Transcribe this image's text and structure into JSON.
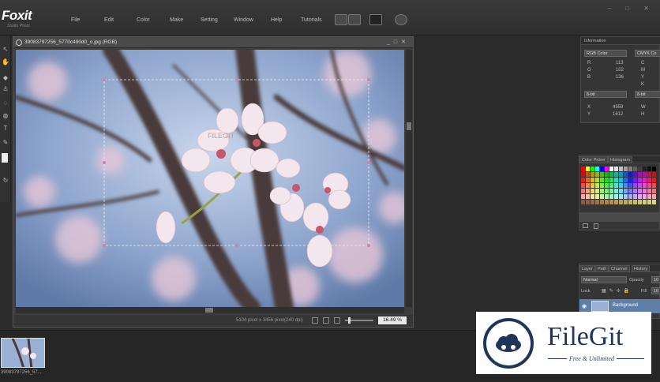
{
  "app": {
    "logo": "Foxit",
    "logo_sub": "Studio Photo"
  },
  "menu": [
    "File",
    "Edit",
    "Color",
    "Make",
    "Setting",
    "Window",
    "Help",
    "Tutorials"
  ],
  "toolbar_icons": [
    "arrange-windows-icon",
    "layer-stack-icon",
    "image-adjust-icon",
    "camera-icon"
  ],
  "left_tools": [
    "move-icon",
    "hand-icon",
    "eraser-icon",
    "clone-stamp-icon",
    "lasso-icon",
    "bucket-icon",
    "text-icon",
    "pen-icon",
    "document-icon",
    "rotate-icon"
  ],
  "document": {
    "title": "39083797256_5770c490d0_o.jpg (RGB)",
    "controls": [
      "_",
      "□",
      "✕"
    ],
    "dimensions": "5104 pixel x 3456 pixel(240 dpi)",
    "zoom": "16.49 %",
    "watermark": "FILEGIT"
  },
  "thumbnail": {
    "name": "39083797256_57..."
  },
  "info_panel": {
    "title": "Information",
    "rgb_mode": "RGB Color",
    "cmyk_mode": "CMYK Co",
    "rgb_labels": [
      "R",
      "G",
      "B"
    ],
    "rgb_values": [
      "113",
      "102",
      "136"
    ],
    "cmyk_labels": [
      "C",
      "M",
      "Y",
      "K"
    ],
    "depth_left": "8-bit",
    "depth_right": "8-bit",
    "coord_labels": [
      "X",
      "Y"
    ],
    "coord_values": [
      "4959",
      "1612"
    ],
    "size_labels": [
      "W",
      "H"
    ]
  },
  "picker_panel": {
    "tabs": [
      "Color Picker",
      "Histogram"
    ]
  },
  "layers_panel": {
    "tabs": [
      "Layer",
      "Path",
      "Channel",
      "History"
    ],
    "blend_mode": "Normal",
    "opacity_label": "Opacity",
    "opacity_value": "10",
    "lock_label": "Lock",
    "fill_label": "Fill",
    "fill_value": "10",
    "layer_name": "Background"
  },
  "watermark_badge": {
    "title": "FileGit",
    "tagline": "Free & Unlimited"
  },
  "colors": {
    "accent_layer": "#5f7fa8",
    "brand_navy": "#1f3658",
    "sky": "#8fa6c8",
    "blossom": "#f3e6ec"
  }
}
